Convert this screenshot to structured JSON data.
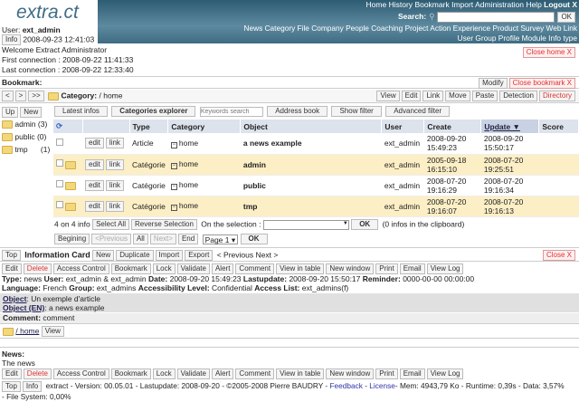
{
  "app": {
    "logo": "extra.ct",
    "user_label": "User:",
    "user": "ext_admin",
    "info": "Info",
    "datetime": "2008-09-23 12:41:03"
  },
  "topnav": {
    "links": [
      "Home",
      "History",
      "Bookmark",
      "Import",
      "Administration",
      "Help"
    ],
    "logout": "Logout X",
    "search_label": "Search:",
    "search_value": "",
    "ok": "OK",
    "modules": [
      "News",
      "Category",
      "File",
      "Company",
      "People",
      "Coaching",
      "Project",
      "Action",
      "Experience",
      "Product",
      "Survey",
      "Web",
      "Link"
    ],
    "admin_modules": [
      "User",
      "Group",
      "Profile",
      "Module",
      "Info type"
    ]
  },
  "welcome": {
    "text": "Welcome Extract Administrator",
    "first": "First connection : 2008-09-22 11:41:33",
    "last": "Last connection : 2008-09-22 12:33:40",
    "close": "Close home X"
  },
  "bookmark": {
    "label": "Bookmark:",
    "modify": "Modify",
    "close": "Close bookmark X"
  },
  "category": {
    "nav": [
      "<",
      ">",
      ">>"
    ],
    "label": "Category:",
    "path": "/ home",
    "actions": [
      "View",
      "Edit",
      "Link",
      "Move",
      "Paste",
      "Detection"
    ],
    "directory": "Directory"
  },
  "sidebar": {
    "up": "Up",
    "new": "New",
    "items": [
      {
        "name": "admin",
        "count": "(3)"
      },
      {
        "name": "public",
        "count": "(0)"
      },
      {
        "name": "tmp",
        "count": "(1)"
      }
    ]
  },
  "tabs": {
    "latest": "Latest infos",
    "explorer": "Categories explorer",
    "keywords_placeholder": "Keywords search",
    "address": "Address book",
    "show_filter": "Show filter",
    "advanced": "Advanced filter"
  },
  "table": {
    "headers": [
      "Type",
      "Category",
      "Object",
      "User",
      "Create",
      "Update ▼",
      "Score"
    ],
    "row_actions": [
      "edit",
      "link"
    ],
    "rows": [
      {
        "type": "Article",
        "category": "home",
        "object": "a news example",
        "user": "ext_admin",
        "create": [
          "2008-09-20",
          "15:49:23"
        ],
        "update": [
          "2008-09-20",
          "15:50:17"
        ],
        "folder": false
      },
      {
        "type": "Catégorie",
        "category": "home",
        "object": "admin",
        "user": "ext_admin",
        "create": [
          "2005-09-18",
          "16:15:10"
        ],
        "update": [
          "2008-07-20",
          "19:25:51"
        ],
        "folder": true
      },
      {
        "type": "Catégorie",
        "category": "home",
        "object": "public",
        "user": "ext_admin",
        "create": [
          "2008-07-20",
          "19:16:29"
        ],
        "update": [
          "2008-07-20",
          "19:16:34"
        ],
        "folder": true
      },
      {
        "type": "Catégorie",
        "category": "home",
        "object": "tmp",
        "user": "ext_admin",
        "create": [
          "2008-07-20",
          "19:16:07"
        ],
        "update": [
          "2008-07-20",
          "19:16:13"
        ],
        "folder": true
      }
    ]
  },
  "selection": {
    "count": "4 on 4 info",
    "select_all": "Select All",
    "reverse": "Reverse Selection",
    "on_selection": "On the selection :",
    "ok": "OK",
    "clipboard": "(0 infos in the clipboard)"
  },
  "pager": {
    "begin": "Begining",
    "prev": "<Previous",
    "all": "All",
    "next": "Next>",
    "end": "End",
    "page": "Page 1",
    "ok": "OK"
  },
  "card": {
    "top": "Top",
    "title": "Information Card",
    "buttons": [
      "New",
      "Duplicate",
      "Import",
      "Export"
    ],
    "prev": "< Previous",
    "next": "Next >",
    "close": "Close X",
    "actions": [
      "Edit",
      "Delete",
      "Access Control",
      "Bookmark",
      "Lock",
      "Validate",
      "Alert",
      "Comment",
      "View in table",
      "New window",
      "Print",
      "Email",
      "View Log"
    ],
    "meta1": [
      [
        "Type:",
        "news"
      ],
      [
        "User:",
        "ext_admin & ext_admin"
      ],
      [
        "Date:",
        "2008-09-20 15:49:23"
      ],
      [
        "Lastupdate:",
        "2008-09-20 15:50:17"
      ],
      [
        "Reminder:",
        "0000-00-00 00:00:00"
      ]
    ],
    "meta2": [
      [
        "Language:",
        "French"
      ],
      [
        "Group:",
        "ext_admins"
      ],
      [
        "Accessibility Level:",
        "Confidential"
      ],
      [
        "Access List:",
        "ext_admins(f)"
      ]
    ],
    "object_label": "Object",
    "object": "Un exemple d'article",
    "object_en_label": "Object (EN)",
    "object_en": "a news example",
    "comment_label": "Comment:",
    "comment": "comment",
    "path": "/ home",
    "view": "View",
    "news_label": "News:",
    "news": "The news"
  },
  "footer": {
    "top": "Top",
    "info": "Info",
    "text": "extract - Version: 00.05.01 - Lastupdate: 2008-09-20 - ©2005-2008  Pierre BAUDRY - ",
    "feedback": "Feedback",
    "sep": " - ",
    "license": "License",
    "stats": "- Mem: 4943,79 Ko - Runtime: 0,39s - Data: 3,57%",
    "fs": "- File System: 0,00%"
  }
}
